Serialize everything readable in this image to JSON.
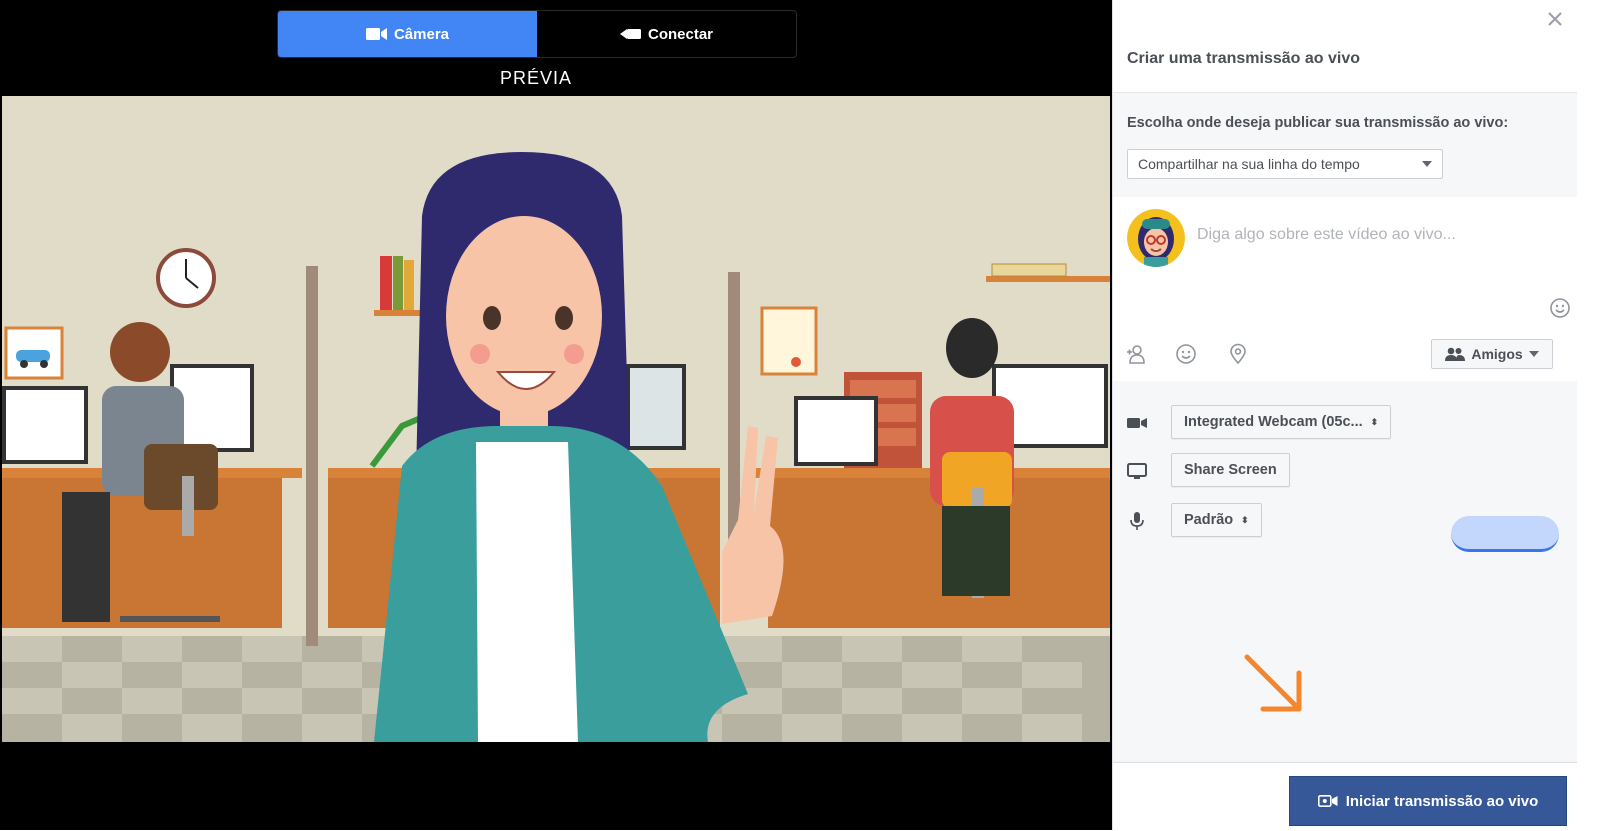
{
  "preview": {
    "tabs": [
      {
        "label": "Câmera",
        "icon": "video-camera-icon",
        "active": true
      },
      {
        "label": "Conectar",
        "icon": "connect-icon",
        "active": false
      }
    ],
    "label": "PRÉVIA"
  },
  "composer": {
    "title": "Criar uma transmissão ao vivo",
    "publish_question": "Escolha onde deseja publicar sua transmissão ao vivo:",
    "timeline_select": "Compartilhar na sua linha do tempo",
    "post_placeholder": "Diga algo sobre este vídeo ao vivo...",
    "privacy_label": "Amigos",
    "devices": {
      "camera": "Integrated Webcam (05c...",
      "screen": "Share Screen",
      "microphone": "Padrão"
    },
    "go_live_label": "Iniciar transmissão ao vivo"
  },
  "colors": {
    "tab_active": "#4285f4",
    "go_live": "#365899",
    "accent_arrow": "#f5862b",
    "audio_meter": "#c2d7fb"
  }
}
